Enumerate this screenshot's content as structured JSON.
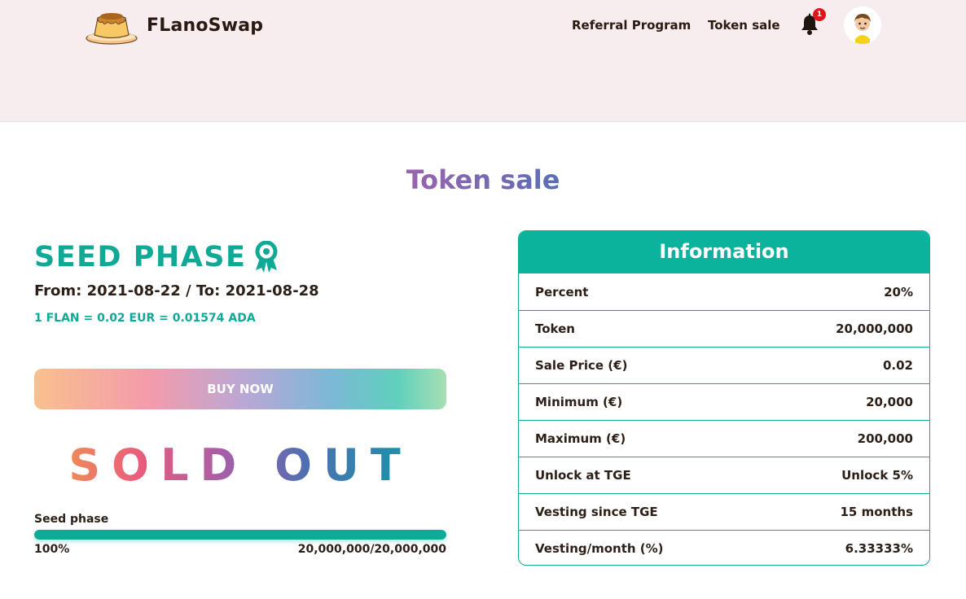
{
  "header": {
    "brand": "FLanoSwap",
    "nav": {
      "referral": "Referral Program",
      "token_sale": "Token sale"
    },
    "notification_count": "1"
  },
  "page": {
    "title": "Token sale"
  },
  "phase": {
    "title": "SEED PHASE",
    "dates": "From: 2021-08-22 / To: 2021-08-28",
    "rate": "1 FLAN = 0.02 EUR = 0.01574 ADA",
    "buy_label": "BUY NOW",
    "sold_out": "SOLD OUT",
    "progress": {
      "label": "Seed phase",
      "percent_text": "100%",
      "percent_value": 100,
      "amount": "20,000,000/20,000,000"
    }
  },
  "info": {
    "title": "Information",
    "rows": [
      {
        "label": "Percent",
        "value": "20%"
      },
      {
        "label": "Token",
        "value": "20,000,000"
      },
      {
        "label": "Sale Price (€)",
        "value": "0.02"
      },
      {
        "label": "Minimum (€)",
        "value": "20,000"
      },
      {
        "label": "Maximum (€)",
        "value": "200,000"
      },
      {
        "label": "Unlock at TGE",
        "value": "Unlock 5%"
      },
      {
        "label": "Vesting since TGE",
        "value": "15 months"
      },
      {
        "label": "Vesting/month (%)",
        "value": "6.33333%"
      }
    ]
  },
  "colors": {
    "accent": "#0bb39c",
    "header_bg": "#f7ecee",
    "text": "#2b1f17",
    "badge": "#e1141b"
  },
  "icons": {
    "logo": "flan-pudding-logo",
    "notification": "bell-icon",
    "profile": "user-avatar",
    "phase_badge": "ribbon-award-icon"
  }
}
